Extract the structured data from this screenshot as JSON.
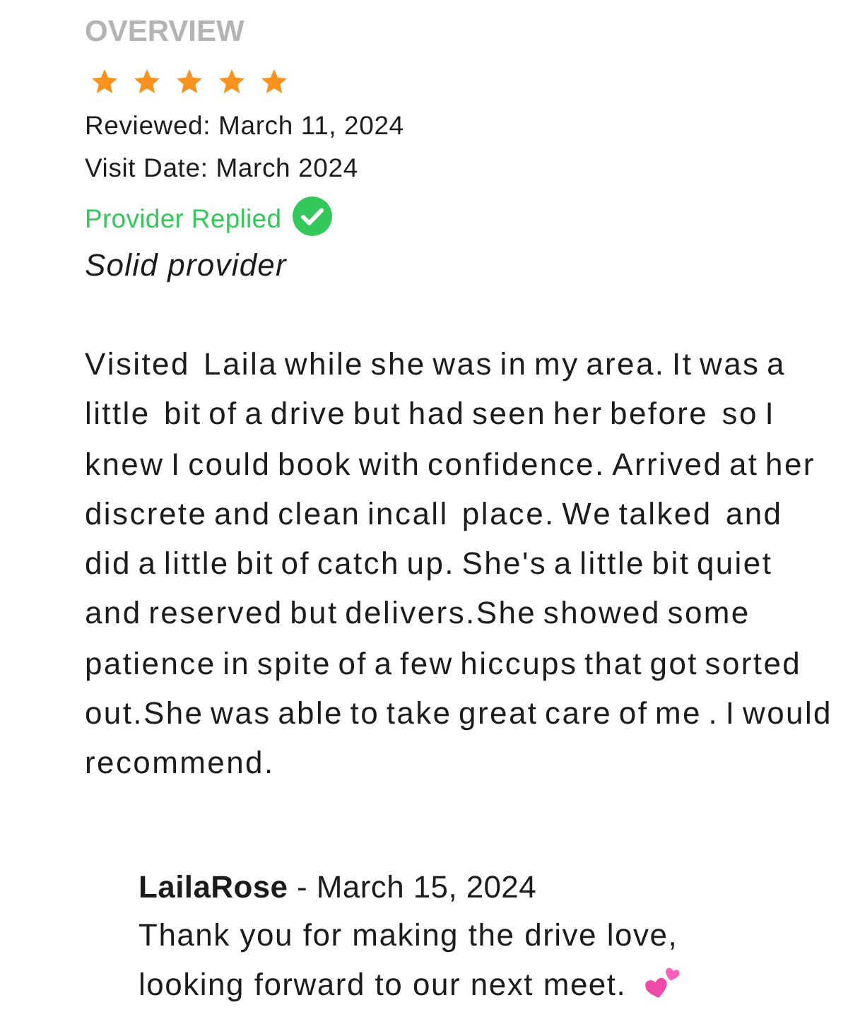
{
  "overview": {
    "heading": "OVERVIEW",
    "stars": 5,
    "reviewed": "Reviewed: March 11, 2024",
    "visit_date": "Visit Date: March 2024",
    "status": "Provider Replied",
    "title": "Solid provider"
  },
  "review": {
    "body": "Visited  Laila while she was in my area. It was a little  bit of a drive but had seen her before  so I knew I could book with confidence. Arrived at her discrete and clean incall  place. We talked  and did a little bit of catch up. She's a little bit quiet and reserved but delivers.She showed some patience in spite of a few hiccups that got sorted out.She was able to take great care of me . I would recommend."
  },
  "reply": {
    "byline": "**LailaRose** - March 15, 2024",
    "lines": [
      "Thank you for making the drive love,",
      "looking forward to our next meet."
    ]
  }
}
